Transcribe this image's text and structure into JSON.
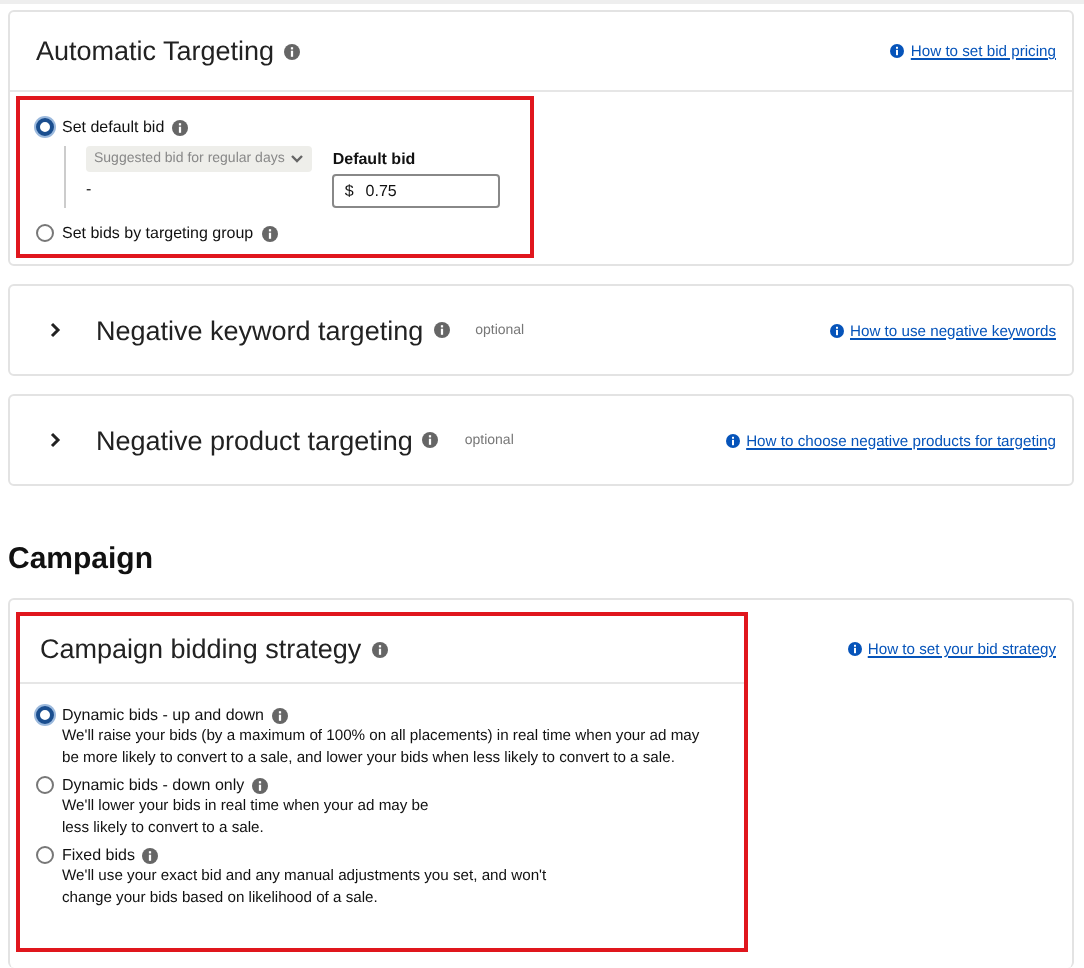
{
  "targeting_card": {
    "title": "Automatic Targeting",
    "help_link": "How to set bid pricing",
    "highlighted": true,
    "options": [
      {
        "label": "Set default bid",
        "selected": true,
        "suggested_dropdown": "Suggested bid for regular days",
        "suggested_value": "-",
        "bid_label": "Default bid",
        "currency": "$",
        "bid_value": "0.75"
      },
      {
        "label": "Set bids by targeting group",
        "selected": false
      }
    ]
  },
  "collapsed_sections": [
    {
      "title": "Negative keyword targeting",
      "tag": "optional",
      "help_link": "How to use negative keywords",
      "expanded": false
    },
    {
      "title": "Negative product targeting",
      "tag": "optional",
      "help_link": "How to choose negative products for targeting",
      "expanded": false
    }
  ],
  "campaign_heading": "Campaign",
  "bidding_card": {
    "title": "Campaign bidding strategy",
    "help_link": "How to set your bid strategy",
    "highlighted": true,
    "options": [
      {
        "label": "Dynamic bids - up and down",
        "selected": true,
        "description": "We'll raise your bids (by a maximum of 100% on all placements) in real time when your ad may\nbe more likely to convert to a sale, and lower your bids when less likely to convert to a sale."
      },
      {
        "label": "Dynamic bids - down only",
        "selected": false,
        "description": "We'll lower your bids in real time when your ad may be\nless likely to convert to a sale."
      },
      {
        "label": "Fixed bids",
        "selected": false,
        "description": "We'll use your exact bid and any manual adjustments you set, and won't\nchange your bids based on likelihood of a sale."
      }
    ]
  }
}
